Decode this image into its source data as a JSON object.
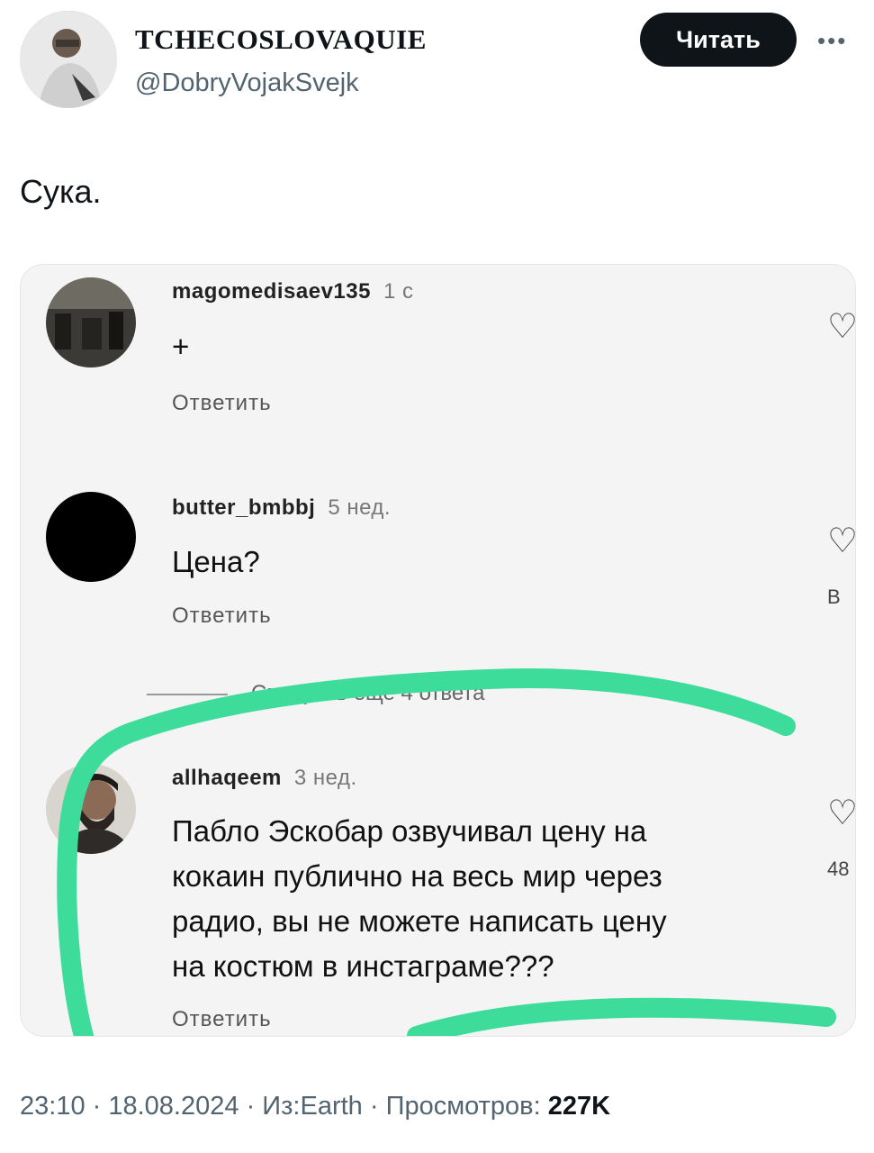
{
  "header": {
    "display_name": "TCHECOSLOVAQUIE",
    "handle": "@DobryVojakSvejk",
    "follow_label": "Читать",
    "more_icon": "more-dots-icon"
  },
  "tweet": {
    "text": "Сука."
  },
  "screenshot": {
    "comments": [
      {
        "user": "magomedisaev135",
        "time": "1 c",
        "text": "+",
        "reply": "Ответить"
      },
      {
        "user": "butter_bmbbj",
        "time": "5 нед.",
        "text": "Цена?",
        "reply": "Ответить",
        "side": "В"
      },
      {
        "user": "allhaqeem",
        "time": "3 нед.",
        "text_lines": [
          "Пабло Эскобар озвучивал цену на",
          "кокаин публично на весь мир через",
          "радио, вы не можете написать цену",
          "на костюм в инстаграме???"
        ],
        "reply": "Ответить",
        "side": "48"
      }
    ],
    "more_replies": "Смотреть еще 4 ответа",
    "highlight_color": "#3ddc9a"
  },
  "meta": {
    "time": "23:10",
    "date": "18.08.2024",
    "source": "Из:Earth",
    "views_label": "Просмотров:",
    "views_value": "227K"
  }
}
